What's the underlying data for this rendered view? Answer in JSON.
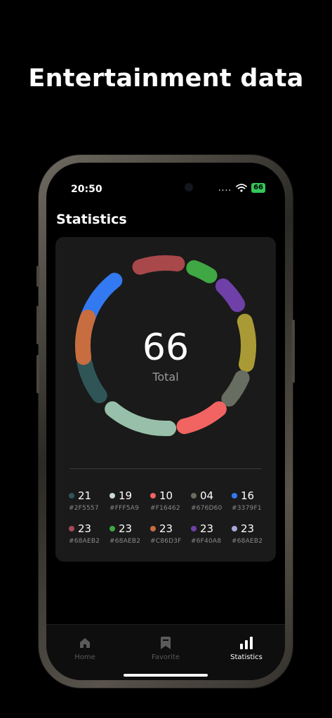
{
  "headline": "Entertainment data",
  "status_bar": {
    "time": "20:50",
    "signal": "....",
    "battery": "66"
  },
  "page_title": "Statistics",
  "total": {
    "value": "66",
    "label": "Total"
  },
  "legend": [
    {
      "value": "21",
      "hex": "#2F5557",
      "color": "#2F5557"
    },
    {
      "value": "19",
      "hex": "#FFF5A9",
      "color": "#C9DCCB"
    },
    {
      "value": "10",
      "hex": "#F16462",
      "color": "#F16462"
    },
    {
      "value": "04",
      "hex": "#676D60",
      "color": "#676D60"
    },
    {
      "value": "16",
      "hex": "#3379F1",
      "color": "#3379F1"
    },
    {
      "value": "23",
      "hex": "#68AEB2",
      "color": "#A8485A"
    },
    {
      "value": "23",
      "hex": "#68AEB2",
      "color": "#3FA844"
    },
    {
      "value": "23",
      "hex": "#C86D3F",
      "color": "#C86D3F"
    },
    {
      "value": "23",
      "hex": "#6F40A8",
      "color": "#6F40A8"
    },
    {
      "value": "23",
      "hex": "#68AEB2",
      "color": "#A8A8D8"
    }
  ],
  "ring_segments": [
    {
      "name": "blue",
      "color": "#3379F1"
    },
    {
      "name": "red",
      "color": "#A8484A"
    },
    {
      "name": "green",
      "color": "#3FA844"
    },
    {
      "name": "purple",
      "color": "#6F40A8"
    },
    {
      "name": "olive",
      "color": "#A99A35"
    },
    {
      "name": "gray",
      "color": "#676D60"
    },
    {
      "name": "coral",
      "color": "#F16462"
    },
    {
      "name": "mint",
      "color": "#97BFA9"
    },
    {
      "name": "teal",
      "color": "#2F5557"
    },
    {
      "name": "orange",
      "color": "#C86D3F"
    }
  ],
  "tabs": [
    {
      "label": "Home",
      "icon": "home-icon",
      "active": false
    },
    {
      "label": "Favorite",
      "icon": "bookmark-icon",
      "active": false
    },
    {
      "label": "Statistics",
      "icon": "bar-chart-icon",
      "active": true
    }
  ]
}
